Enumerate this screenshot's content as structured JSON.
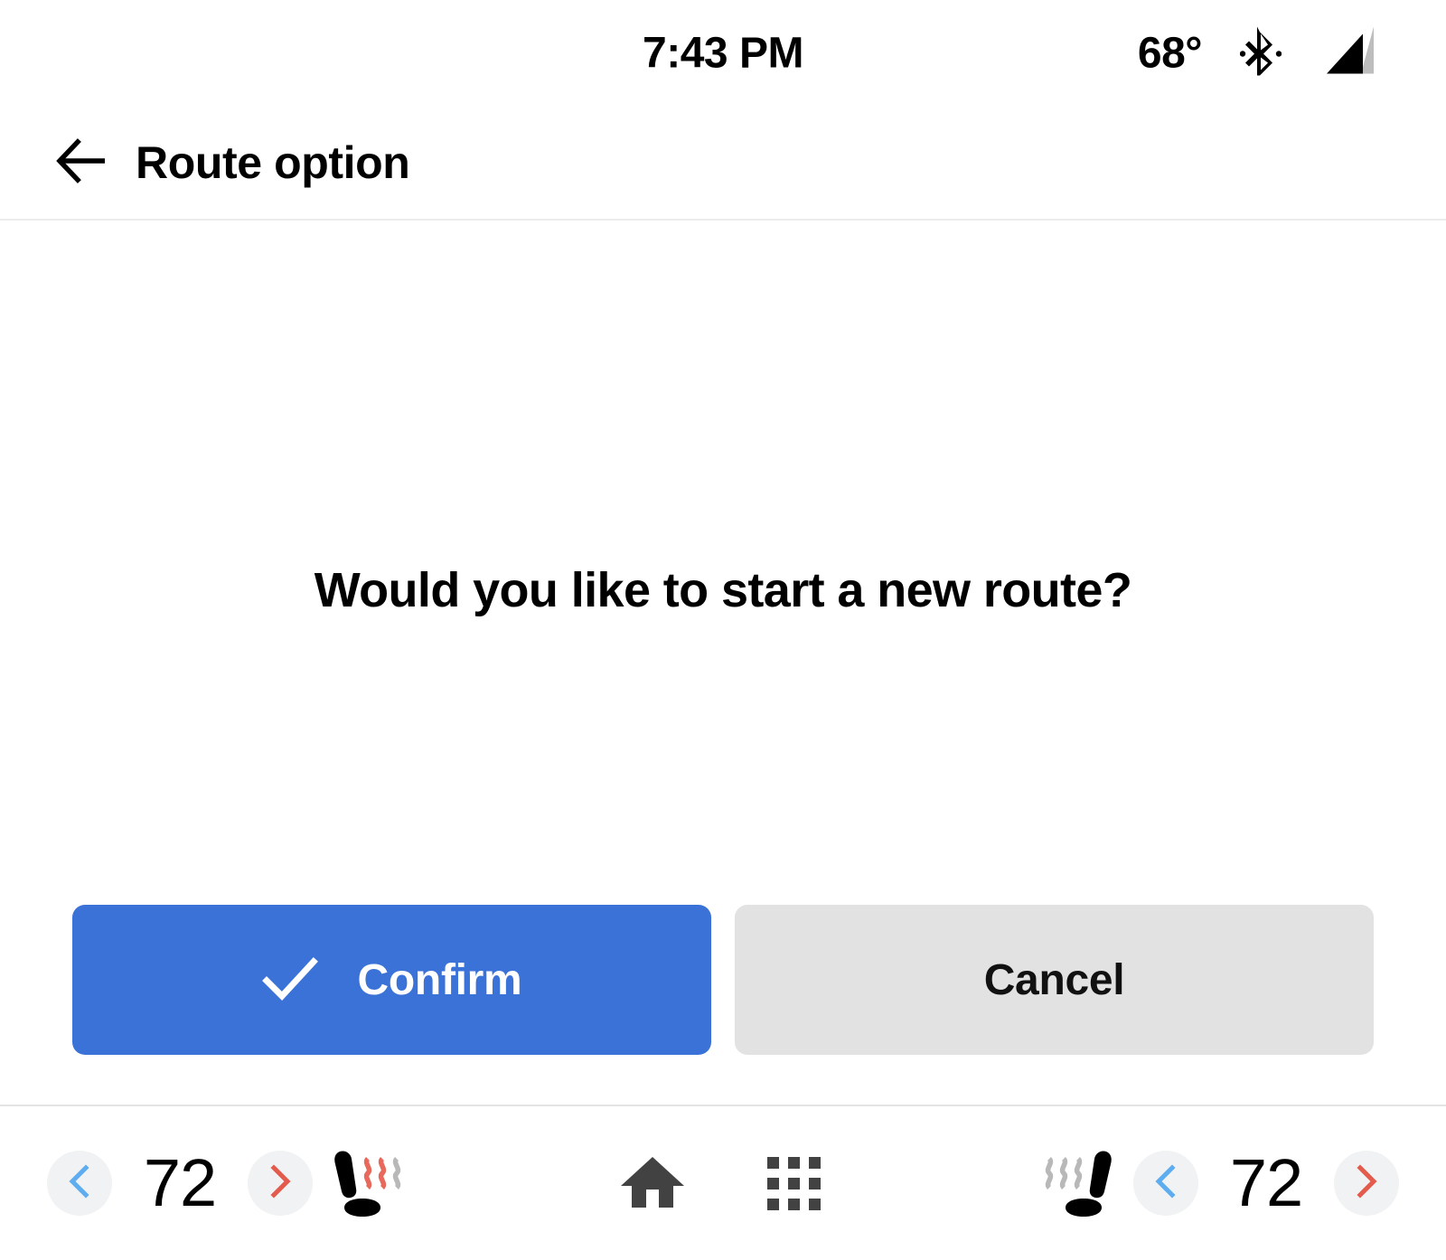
{
  "status_bar": {
    "time": "7:43 PM",
    "temperature": "68°",
    "bluetooth_icon": "bluetooth-icon",
    "signal_icon": "cellular-signal-icon"
  },
  "header": {
    "back_icon": "back-arrow-icon",
    "title": "Route option"
  },
  "main": {
    "prompt": "Would you like to start a new route?",
    "buttons": {
      "confirm": {
        "label": "Confirm",
        "icon": "check-icon",
        "color": "#3a72d8",
        "text_color": "#ffffff"
      },
      "cancel": {
        "label": "Cancel",
        "color": "#e2e2e2",
        "text_color": "#111111"
      }
    }
  },
  "bottom_bar": {
    "driver_climate": {
      "decrease_label": "‹",
      "temperature": "72",
      "increase_label": "›",
      "seat_icon": "heated-seat-icon-left",
      "seat_heat_level": 2,
      "seat_heat_max": 3
    },
    "passenger_climate": {
      "seat_icon": "heated-seat-icon-right",
      "seat_heat_level": 0,
      "seat_heat_max": 3,
      "decrease_label": "‹",
      "temperature": "72",
      "increase_label": "›"
    },
    "home_icon": "home-icon",
    "apps_icon": "apps-grid-icon"
  },
  "colors": {
    "accent_blue": "#3a72d8",
    "chevron_cool": "#5dadf0",
    "chevron_warm": "#e35b4c",
    "circle_bg": "#f0f2f3",
    "cancel_bg": "#e2e2e2",
    "divider": "#e4e4e4",
    "icon_dark": "#424242",
    "heat_active": "#e8685c",
    "heat_inactive": "#b8b8b8"
  }
}
